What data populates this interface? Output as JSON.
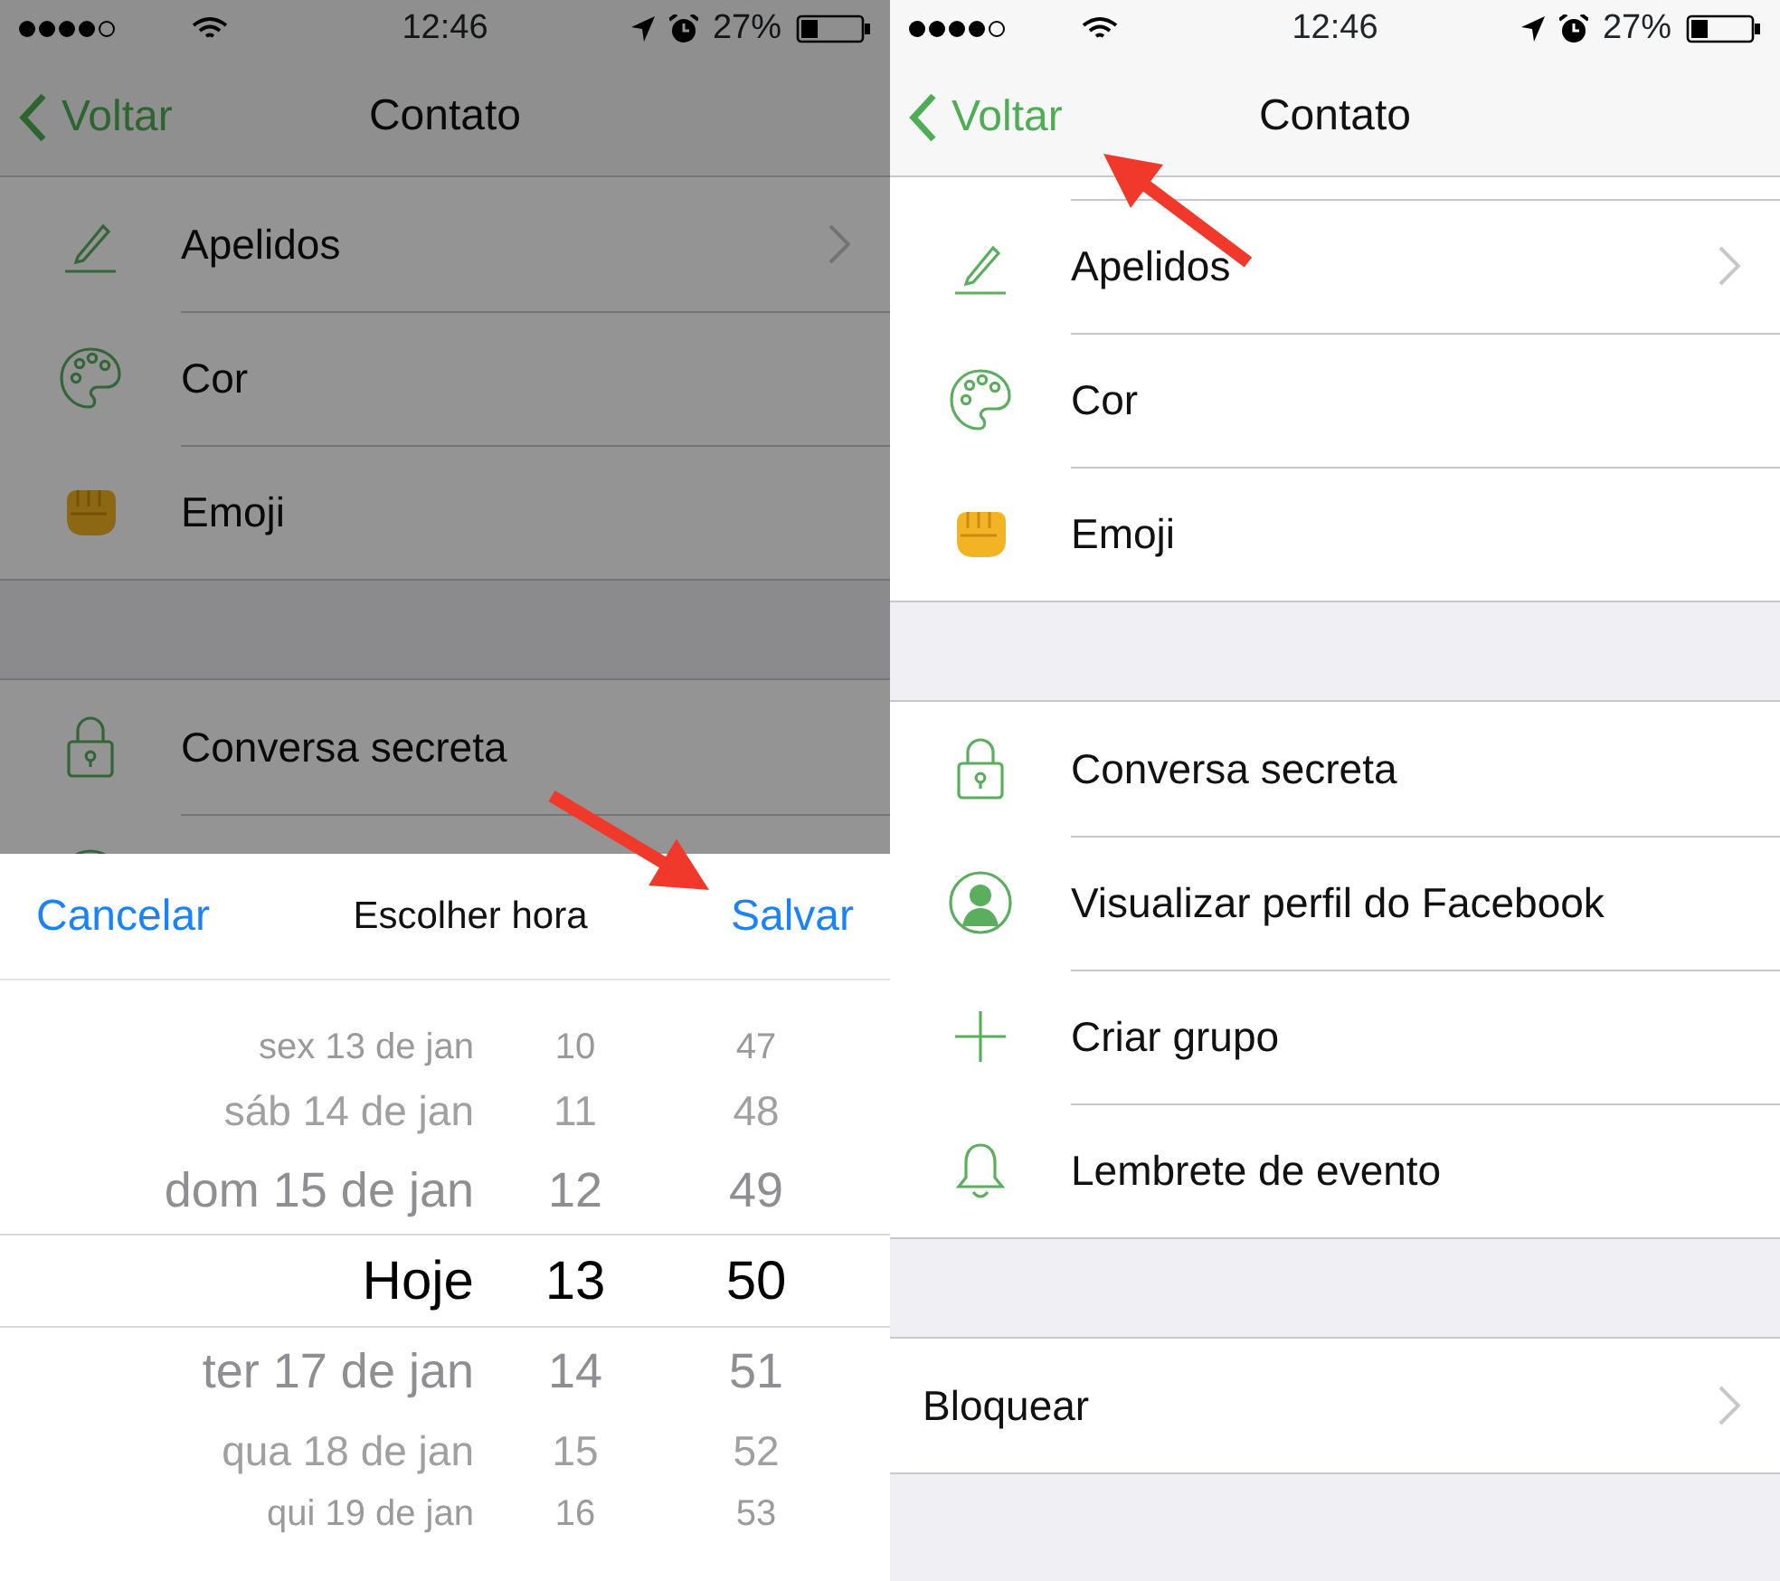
{
  "screens": [
    {
      "status_bar": {
        "time": "12:46",
        "battery": "27%"
      },
      "nav": {
        "back": "Voltar",
        "title": "Contato"
      },
      "arrow": true,
      "sections": [
        {
          "rows": [
            {
              "kind": "pencil",
              "label": "Apelidos",
              "chevron": true
            },
            {
              "kind": "palette",
              "label": "Cor"
            },
            {
              "kind": "fist",
              "label": "Emoji"
            }
          ]
        },
        {
          "rows": [
            {
              "kind": "lock",
              "label": "Conversa secreta"
            },
            {
              "kind": "profile"
            }
          ]
        }
      ],
      "sheet": {
        "cancel": "Cancelar",
        "title": "Escolher hora",
        "save": "Salvar",
        "picker": [
          {
            "date": "sex 13 de jan",
            "hour": "10",
            "minute": "47",
            "selected": false
          },
          {
            "date": "sáb 14 de jan",
            "hour": "11",
            "minute": "48",
            "selected": false
          },
          {
            "date": "dom 15 de jan",
            "hour": "12",
            "minute": "49",
            "selected": false
          },
          {
            "date": "Hoje",
            "hour": "13",
            "minute": "50",
            "selected": true
          },
          {
            "date": "ter 17 de jan",
            "hour": "14",
            "minute": "51",
            "selected": false
          },
          {
            "date": "qua 18 de jan",
            "hour": "15",
            "minute": "52",
            "selected": false
          },
          {
            "date": "qui 19 de jan",
            "hour": "16",
            "minute": "53",
            "selected": false
          }
        ]
      }
    },
    {
      "status_bar": {
        "time": "12:46",
        "battery": "27%"
      },
      "nav": {
        "back": "Voltar",
        "title": "Contato"
      },
      "arrow": true,
      "sections": [
        {
          "rows": [
            {
              "kind": "pencil",
              "label": "Apelidos",
              "chevron": true
            },
            {
              "kind": "palette",
              "label": "Cor"
            },
            {
              "kind": "fist",
              "label": "Emoji"
            }
          ]
        },
        {
          "rows": [
            {
              "kind": "lock",
              "label": "Conversa secreta"
            },
            {
              "kind": "profile",
              "label": "Visualizar perfil do Facebook"
            },
            {
              "kind": "plus",
              "label": "Criar grupo"
            },
            {
              "kind": "bell",
              "label": "Lembrete de evento"
            }
          ]
        },
        {
          "rows": [
            {
              "label": "Bloquear",
              "chevron": true
            }
          ]
        }
      ]
    }
  ]
}
